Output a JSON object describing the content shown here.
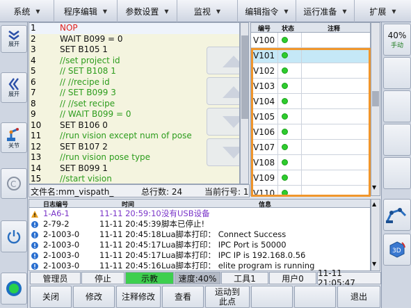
{
  "menu": [
    {
      "label": "系统",
      "caret": "▼"
    },
    {
      "label": "程序编辑",
      "caret": "▼"
    },
    {
      "label": "参数设置",
      "caret": "▼"
    },
    {
      "label": "监视",
      "caret": "▼"
    },
    {
      "label": "编辑指令",
      "caret": "▼"
    },
    {
      "label": "运行准备",
      "caret": "▼"
    },
    {
      "label": "扩展",
      "caret": "▼"
    }
  ],
  "left_side": {
    "expand1": "展开",
    "expand2": "展开",
    "joint": "关节"
  },
  "right_side": {
    "speed": "40%",
    "mode": "手动"
  },
  "code_lines": [
    {
      "n": "1",
      "t": "NOP"
    },
    {
      "n": "2",
      "t": "WAIT B099 = 0"
    },
    {
      "n": "3",
      "t": "SET B105 1"
    },
    {
      "n": "4",
      "t": "//set project id"
    },
    {
      "n": "5",
      "t": "// SET B108 1"
    },
    {
      "n": "6",
      "t": "// //recipe id"
    },
    {
      "n": "7",
      "t": "// SET B099 3"
    },
    {
      "n": "8",
      "t": "// //set recipe"
    },
    {
      "n": "9",
      "t": "// WAIT B099 = 0"
    },
    {
      "n": "10",
      "t": "SET B106 0"
    },
    {
      "n": "11",
      "t": "//run vision except num of pose"
    },
    {
      "n": "12",
      "t": "SET B107 2"
    },
    {
      "n": "13",
      "t": "//run vision pose type"
    },
    {
      "n": "14",
      "t": "SET B099 1"
    },
    {
      "n": "15",
      "t": "//start vision"
    }
  ],
  "code_colors": {
    "nop": "#e0201c",
    "comment": "#2c9c1c",
    "normal": "#111111"
  },
  "reg_table": {
    "headers": {
      "id": "编号",
      "state": "状态",
      "note": "注释"
    },
    "rows": [
      "V100",
      "V101",
      "V102",
      "V103",
      "V104",
      "V105",
      "V106",
      "V107",
      "V108",
      "V109",
      "V110"
    ],
    "selected": "V101"
  },
  "file_status": {
    "filename": "文件名:mm_vispath_",
    "total": "总行数: 24",
    "current": "当前行号: 1"
  },
  "log_table": {
    "headers": {
      "id": "日志编号",
      "time": "时间",
      "info": "信息"
    },
    "rows": [
      {
        "icon": "warning",
        "id": "1-A6-1",
        "time": "11-11 20:59:10",
        "msg": "没有USB设备"
      },
      {
        "icon": "info",
        "id": "2-79-2",
        "time": "11-11 20:45:39",
        "msg": "脚本已停止!"
      },
      {
        "icon": "info",
        "id": "2-1003-0",
        "time": "11-11 20:45:18",
        "msg": "Lua脚本打印： Connect Success"
      },
      {
        "icon": "info",
        "id": "2-1003-0",
        "time": "11-11 20:45:17",
        "msg": "Lua脚本打印： IPC Port is 50000"
      },
      {
        "icon": "info",
        "id": "2-1003-0",
        "time": "11-11 20:45:17",
        "msg": "Lua脚本打印： IPC IP is 192.168.0.56"
      },
      {
        "icon": "info",
        "id": "2-1003-0",
        "time": "11-11 20:45:16",
        "msg": "Lua脚本打印： elite program is running"
      }
    ]
  },
  "status_bar": {
    "user": "管理员",
    "run": "停止",
    "mode": "示教",
    "speed": "速度:40%",
    "tool": "工具1",
    "usr": "用户0",
    "clock": "11-11 21:05:47"
  },
  "bottom_buttons": {
    "close": "关闭",
    "modify": "修改",
    "comment_modify": "注释修改",
    "view": "查看",
    "move_to_point": "运动到此点",
    "exit": "退出"
  }
}
